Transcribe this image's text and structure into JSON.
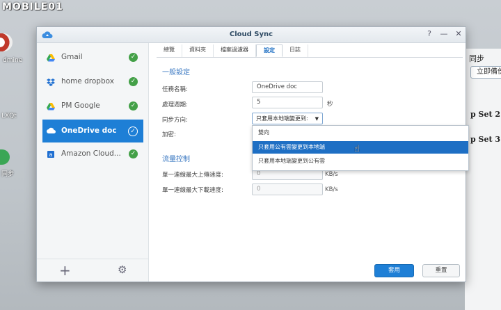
{
  "watermark": "MOBILE01",
  "desktop": {
    "icons": [
      {
        "label": "dmine"
      },
      {
        "label": "LXQt"
      },
      {
        "label": "同步"
      }
    ],
    "background_window": {
      "label_top": "同步",
      "button": "立即備份",
      "items": [
        "p Set 2",
        "p Set 3"
      ]
    }
  },
  "window": {
    "title": "Cloud Sync",
    "controls": {
      "help": "?",
      "minimize": "—",
      "close": "✕"
    }
  },
  "sidebar": {
    "accounts": [
      {
        "name": "Gmail",
        "icon": "google-drive-icon",
        "status": "ok"
      },
      {
        "name": "home dropbox",
        "icon": "dropbox-icon",
        "status": "ok"
      },
      {
        "name": "PM Google",
        "icon": "google-drive-icon",
        "status": "ok"
      },
      {
        "name": "OneDrive doc",
        "icon": "onedrive-icon",
        "status": "ok",
        "selected": true
      },
      {
        "name": "Amazon Cloud...",
        "icon": "amazon-cloud-icon",
        "status": "ok"
      }
    ],
    "add": "+",
    "settings": "⚙"
  },
  "tabs": [
    "總覽",
    "資料夾",
    "檔案過濾器",
    "設定",
    "日誌"
  ],
  "active_tab": "設定",
  "general": {
    "heading": "一般設定",
    "task_name_label": "任務名稱:",
    "task_name_value": "OneDrive doc",
    "interval_label": "處理週期:",
    "interval_value": "5",
    "interval_unit": "秒",
    "direction_label": "同步方向:",
    "direction_value": "只套用本地端變更到:",
    "encrypt_label": "加密:"
  },
  "dropdown_options": [
    "雙向",
    "只套用公有雲變更到本地端",
    "只套用本地端變更到公有雲"
  ],
  "traffic": {
    "heading": "流量控制",
    "upload_label": "單一連線最大上傳速度:",
    "upload_value": "0",
    "download_label": "單一連線最大下載速度:",
    "download_value": "0",
    "unit": "KB/s"
  },
  "buttons": {
    "apply": "套用",
    "reset": "重置"
  },
  "colors": {
    "accent": "#1e7fd6",
    "ok": "#43a047"
  }
}
